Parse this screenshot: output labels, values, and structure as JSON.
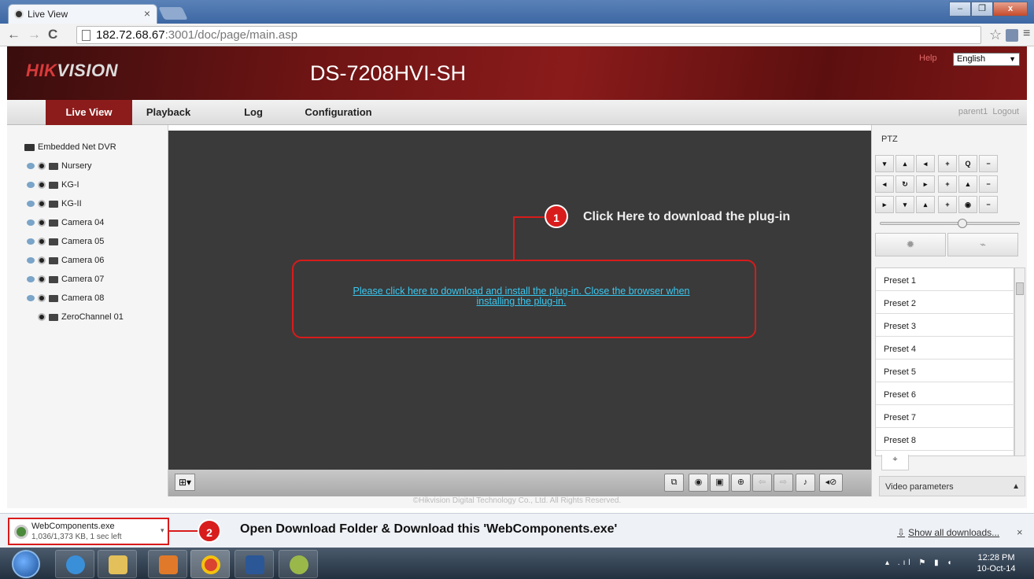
{
  "browser": {
    "tab_title": "Live View",
    "tab_close": "×",
    "url_host": "182.72.68.67",
    "url_rest": ":3001/doc/page/main.asp",
    "back": "←",
    "forward": "→",
    "reload": "C",
    "star": "☆",
    "menu": "≡",
    "win_min": "–",
    "win_max": "❐",
    "win_close": "x"
  },
  "header": {
    "logo_red": "HIK",
    "logo_rest": "VISION",
    "model": "DS-7208HVI-SH",
    "help": "Help",
    "language": "English"
  },
  "nav": {
    "items": [
      "Live View",
      "Playback",
      "Log",
      "Configuration"
    ],
    "active": "Live View",
    "user": "parent1",
    "logout": "Logout"
  },
  "tree": {
    "root": "Embedded Net DVR",
    "channels": [
      "Nursery",
      "KG-I",
      "KG-II",
      "Camera 04",
      "Camera 05",
      "Camera 06",
      "Camera 07",
      "Camera 08",
      "ZeroChannel 01"
    ]
  },
  "video": {
    "plugin_line1": "Please click here to download and install the plug-in. Close the browser when",
    "plugin_line2": "installing the plug-in."
  },
  "annotations": {
    "badge1": "1",
    "text1": "Click Here to download the plug-in",
    "badge2": "2",
    "text2": "Open Download Folder & Download this 'WebComponents.exe'"
  },
  "ptz": {
    "label": "PTZ",
    "presets": [
      "Preset 1",
      "Preset 2",
      "Preset 3",
      "Preset 4",
      "Preset 5",
      "Preset 6",
      "Preset 7",
      "Preset 8"
    ],
    "video_params": "Video parameters"
  },
  "footer": "©Hikvision Digital Technology Co., Ltd. All Rights Reserved.",
  "download": {
    "filename": "WebComponents.exe",
    "progress": "1,036/1,373 KB, 1 sec left",
    "show_all": "Show all downloads...",
    "close": "×"
  },
  "taskbar": {
    "time": "12:28 PM",
    "date": "10-Oct-14"
  },
  "colors": {
    "accent_red": "#d91b1b",
    "nav_active": "#8c1c1c",
    "plugin_link": "#3ac8f0"
  }
}
